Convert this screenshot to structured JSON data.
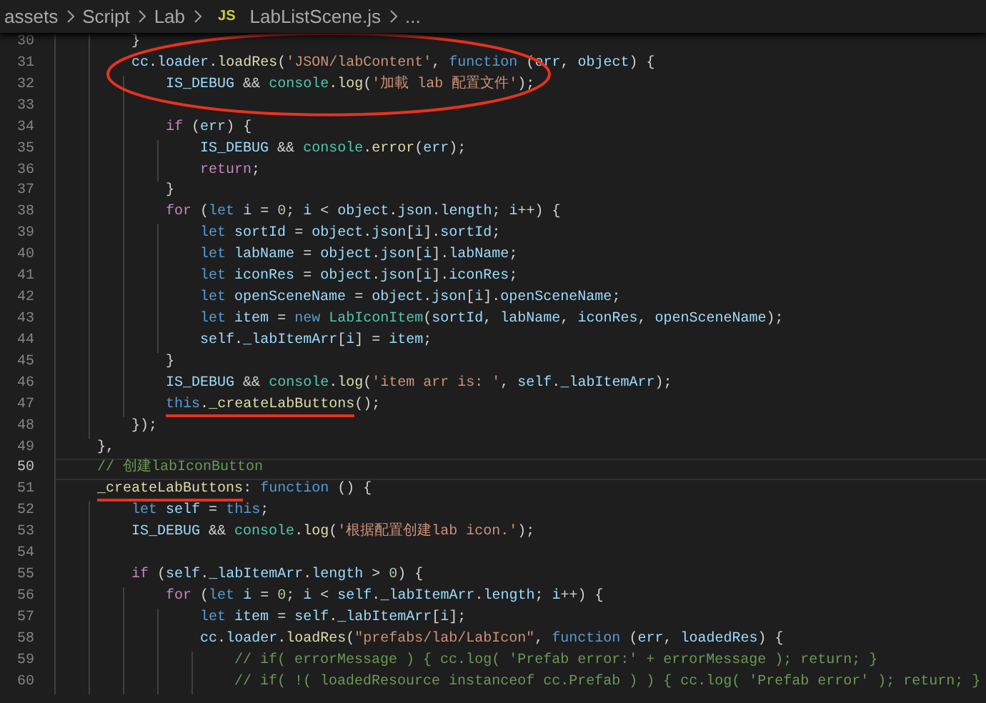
{
  "breadcrumbs": [
    {
      "label": "assets"
    },
    {
      "label": "Script"
    },
    {
      "label": "Lab"
    },
    {
      "label": "LabListScene.js",
      "badge": "JS"
    },
    {
      "label": "..."
    }
  ],
  "lines": [
    {
      "number": "30",
      "current": false,
      "circled": false,
      "tokens": [
        {
          "text": "        }",
          "kind": "plain"
        }
      ]
    },
    {
      "number": "31",
      "current": false,
      "circled": true,
      "tokens": [
        {
          "text": "        cc",
          "kind": "var"
        },
        {
          "text": ".",
          "kind": "plain"
        },
        {
          "text": "loader",
          "kind": "var"
        },
        {
          "text": ".",
          "kind": "plain"
        },
        {
          "text": "loadRes",
          "kind": "function"
        },
        {
          "text": "(",
          "kind": "plain"
        },
        {
          "text": "'JSON/labContent'",
          "kind": "string"
        },
        {
          "text": ", ",
          "kind": "plain"
        },
        {
          "text": "function",
          "kind": "keyword"
        },
        {
          "text": " (",
          "kind": "plain"
        },
        {
          "text": "err",
          "kind": "var"
        },
        {
          "text": ", ",
          "kind": "plain"
        },
        {
          "text": "object",
          "kind": "var"
        },
        {
          "text": ") {",
          "kind": "plain"
        }
      ]
    },
    {
      "number": "32",
      "current": false,
      "circled": true,
      "tokens": [
        {
          "text": "            IS_DEBUG",
          "kind": "var"
        },
        {
          "text": " && ",
          "kind": "plain"
        },
        {
          "text": "console",
          "kind": "type"
        },
        {
          "text": ".",
          "kind": "plain"
        },
        {
          "text": "log",
          "kind": "function"
        },
        {
          "text": "(",
          "kind": "plain"
        },
        {
          "text": "'加載 lab 配置文件'",
          "kind": "string"
        },
        {
          "text": ");",
          "kind": "plain"
        }
      ]
    },
    {
      "number": "33",
      "current": false,
      "circled": false
    },
    {
      "number": "34",
      "current": false,
      "circled": false,
      "tokens": [
        {
          "text": "            if",
          "kind": "control"
        },
        {
          "text": " (",
          "kind": "plain"
        },
        {
          "text": "err",
          "kind": "var"
        },
        {
          "text": ") {",
          "kind": "plain"
        }
      ]
    },
    {
      "number": "35",
      "current": false,
      "circled": false,
      "tokens": [
        {
          "text": "                IS_DEBUG",
          "kind": "var"
        },
        {
          "text": " && ",
          "kind": "plain"
        },
        {
          "text": "console",
          "kind": "type"
        },
        {
          "text": ".",
          "kind": "plain"
        },
        {
          "text": "error",
          "kind": "function"
        },
        {
          "text": "(",
          "kind": "plain"
        },
        {
          "text": "err",
          "kind": "var"
        },
        {
          "text": ");",
          "kind": "plain"
        }
      ]
    },
    {
      "number": "36",
      "current": false,
      "circled": false,
      "tokens": [
        {
          "text": "                return",
          "kind": "control"
        },
        {
          "text": ";",
          "kind": "plain"
        }
      ]
    },
    {
      "number": "37",
      "current": false,
      "circled": false,
      "tokens": [
        {
          "text": "            }",
          "kind": "plain"
        }
      ]
    },
    {
      "number": "38",
      "current": false,
      "circled": false,
      "tokens": [
        {
          "text": "            for",
          "kind": "control"
        },
        {
          "text": " (",
          "kind": "plain"
        },
        {
          "text": "let ",
          "kind": "keyword"
        },
        {
          "text": "i",
          "kind": "var"
        },
        {
          "text": " = ",
          "kind": "plain"
        },
        {
          "text": "0",
          "kind": "number"
        },
        {
          "text": "; ",
          "kind": "plain"
        },
        {
          "text": "i",
          "kind": "var"
        },
        {
          "text": " < ",
          "kind": "plain"
        },
        {
          "text": "object",
          "kind": "var"
        },
        {
          "text": ".",
          "kind": "plain"
        },
        {
          "text": "json",
          "kind": "var"
        },
        {
          "text": ".",
          "kind": "plain"
        },
        {
          "text": "length",
          "kind": "var"
        },
        {
          "text": "; ",
          "kind": "plain"
        },
        {
          "text": "i",
          "kind": "var"
        },
        {
          "text": "++) {",
          "kind": "plain"
        }
      ]
    },
    {
      "number": "39",
      "current": false,
      "circled": false,
      "tokens": [
        {
          "text": "                let ",
          "kind": "keyword"
        },
        {
          "text": "sortId",
          "kind": "var"
        },
        {
          "text": " = ",
          "kind": "plain"
        },
        {
          "text": "object",
          "kind": "var"
        },
        {
          "text": ".",
          "kind": "plain"
        },
        {
          "text": "json",
          "kind": "var"
        },
        {
          "text": "[",
          "kind": "plain"
        },
        {
          "text": "i",
          "kind": "var"
        },
        {
          "text": "].",
          "kind": "plain"
        },
        {
          "text": "sortId",
          "kind": "var"
        },
        {
          "text": ";",
          "kind": "plain"
        }
      ]
    },
    {
      "number": "40",
      "current": false,
      "circled": false,
      "tokens": [
        {
          "text": "                let ",
          "kind": "keyword"
        },
        {
          "text": "labName",
          "kind": "var"
        },
        {
          "text": " = ",
          "kind": "plain"
        },
        {
          "text": "object",
          "kind": "var"
        },
        {
          "text": ".",
          "kind": "plain"
        },
        {
          "text": "json",
          "kind": "var"
        },
        {
          "text": "[",
          "kind": "plain"
        },
        {
          "text": "i",
          "kind": "var"
        },
        {
          "text": "].",
          "kind": "plain"
        },
        {
          "text": "labName",
          "kind": "var"
        },
        {
          "text": ";",
          "kind": "plain"
        }
      ]
    },
    {
      "number": "41",
      "current": false,
      "circled": false,
      "tokens": [
        {
          "text": "                let ",
          "kind": "keyword"
        },
        {
          "text": "iconRes",
          "kind": "var"
        },
        {
          "text": " = ",
          "kind": "plain"
        },
        {
          "text": "object",
          "kind": "var"
        },
        {
          "text": ".",
          "kind": "plain"
        },
        {
          "text": "json",
          "kind": "var"
        },
        {
          "text": "[",
          "kind": "plain"
        },
        {
          "text": "i",
          "kind": "var"
        },
        {
          "text": "].",
          "kind": "plain"
        },
        {
          "text": "iconRes",
          "kind": "var"
        },
        {
          "text": ";",
          "kind": "plain"
        }
      ]
    },
    {
      "number": "42",
      "current": false,
      "circled": false,
      "tokens": [
        {
          "text": "                let ",
          "kind": "keyword"
        },
        {
          "text": "openSceneName",
          "kind": "var"
        },
        {
          "text": " = ",
          "kind": "plain"
        },
        {
          "text": "object",
          "kind": "var"
        },
        {
          "text": ".",
          "kind": "plain"
        },
        {
          "text": "json",
          "kind": "var"
        },
        {
          "text": "[",
          "kind": "plain"
        },
        {
          "text": "i",
          "kind": "var"
        },
        {
          "text": "].",
          "kind": "plain"
        },
        {
          "text": "openSceneName",
          "kind": "var"
        },
        {
          "text": ";",
          "kind": "plain"
        }
      ]
    },
    {
      "number": "43",
      "current": false,
      "circled": false,
      "tokens": [
        {
          "text": "                let ",
          "kind": "keyword"
        },
        {
          "text": "item",
          "kind": "var"
        },
        {
          "text": " = ",
          "kind": "plain"
        },
        {
          "text": "new ",
          "kind": "keyword"
        },
        {
          "text": "LabIconItem",
          "kind": "type"
        },
        {
          "text": "(",
          "kind": "plain"
        },
        {
          "text": "sortId",
          "kind": "var"
        },
        {
          "text": ", ",
          "kind": "plain"
        },
        {
          "text": "labName",
          "kind": "var"
        },
        {
          "text": ", ",
          "kind": "plain"
        },
        {
          "text": "iconRes",
          "kind": "var"
        },
        {
          "text": ", ",
          "kind": "plain"
        },
        {
          "text": "openSceneName",
          "kind": "var"
        },
        {
          "text": ");",
          "kind": "plain"
        }
      ]
    },
    {
      "number": "44",
      "current": false,
      "circled": false,
      "tokens": [
        {
          "text": "                self",
          "kind": "var"
        },
        {
          "text": ".",
          "kind": "plain"
        },
        {
          "text": "_labItemArr",
          "kind": "var"
        },
        {
          "text": "[",
          "kind": "plain"
        },
        {
          "text": "i",
          "kind": "var"
        },
        {
          "text": "] = ",
          "kind": "plain"
        },
        {
          "text": "item",
          "kind": "var"
        },
        {
          "text": ";",
          "kind": "plain"
        }
      ]
    },
    {
      "number": "45",
      "current": false,
      "circled": false,
      "tokens": [
        {
          "text": "            }",
          "kind": "plain"
        }
      ]
    },
    {
      "number": "46",
      "current": false,
      "circled": false,
      "tokens": [
        {
          "text": "            IS_DEBUG",
          "kind": "var"
        },
        {
          "text": " && ",
          "kind": "plain"
        },
        {
          "text": "console",
          "kind": "type"
        },
        {
          "text": ".",
          "kind": "plain"
        },
        {
          "text": "log",
          "kind": "function"
        },
        {
          "text": "(",
          "kind": "plain"
        },
        {
          "text": "'item arr is: '",
          "kind": "string"
        },
        {
          "text": ", ",
          "kind": "plain"
        },
        {
          "text": "self",
          "kind": "var"
        },
        {
          "text": ".",
          "kind": "plain"
        },
        {
          "text": "_labItemArr",
          "kind": "var"
        },
        {
          "text": ");",
          "kind": "plain"
        }
      ]
    },
    {
      "number": "47",
      "current": false,
      "circled": false,
      "tokens": [
        {
          "text": "            this",
          "kind": "keyword",
          "underlined": true
        },
        {
          "text": ".",
          "kind": "plain",
          "underlined": true
        },
        {
          "text": "_createLabButtons",
          "kind": "function",
          "underlined": true
        },
        {
          "text": "();",
          "kind": "plain"
        }
      ]
    },
    {
      "number": "48",
      "current": false,
      "circled": false,
      "tokens": [
        {
          "text": "        });",
          "kind": "plain"
        }
      ]
    },
    {
      "number": "49",
      "current": false,
      "circled": false,
      "tokens": [
        {
          "text": "    },",
          "kind": "plain"
        }
      ]
    },
    {
      "number": "50",
      "current": true,
      "circled": false,
      "tokens": [
        {
          "text": "    // 创建labIconButton",
          "kind": "comment"
        }
      ]
    },
    {
      "number": "51",
      "current": false,
      "circled": false,
      "tokens": [
        {
          "text": "    _createLabButtons",
          "kind": "function",
          "underlined": true
        },
        {
          "text": ": ",
          "kind": "plain"
        },
        {
          "text": "function",
          "kind": "keyword"
        },
        {
          "text": " () {",
          "kind": "plain"
        }
      ]
    },
    {
      "number": "52",
      "current": false,
      "circled": false,
      "tokens": [
        {
          "text": "        let ",
          "kind": "keyword"
        },
        {
          "text": "self",
          "kind": "var"
        },
        {
          "text": " = ",
          "kind": "plain"
        },
        {
          "text": "this",
          "kind": "keyword"
        },
        {
          "text": ";",
          "kind": "plain"
        }
      ]
    },
    {
      "number": "53",
      "current": false,
      "circled": false,
      "tokens": [
        {
          "text": "        IS_DEBUG",
          "kind": "var"
        },
        {
          "text": " && ",
          "kind": "plain"
        },
        {
          "text": "console",
          "kind": "type"
        },
        {
          "text": ".",
          "kind": "plain"
        },
        {
          "text": "log",
          "kind": "function"
        },
        {
          "text": "(",
          "kind": "plain"
        },
        {
          "text": "'根据配置创建lab icon.'",
          "kind": "string"
        },
        {
          "text": ");",
          "kind": "plain"
        }
      ]
    },
    {
      "number": "54",
      "current": false,
      "circled": false
    },
    {
      "number": "55",
      "current": false,
      "circled": false,
      "tokens": [
        {
          "text": "        if",
          "kind": "control"
        },
        {
          "text": " (",
          "kind": "plain"
        },
        {
          "text": "self",
          "kind": "var"
        },
        {
          "text": ".",
          "kind": "plain"
        },
        {
          "text": "_labItemArr",
          "kind": "var"
        },
        {
          "text": ".",
          "kind": "plain"
        },
        {
          "text": "length",
          "kind": "var"
        },
        {
          "text": " > ",
          "kind": "plain"
        },
        {
          "text": "0",
          "kind": "number"
        },
        {
          "text": ") {",
          "kind": "plain"
        }
      ]
    },
    {
      "number": "56",
      "current": false,
      "circled": false,
      "tokens": [
        {
          "text": "            for",
          "kind": "control"
        },
        {
          "text": " (",
          "kind": "plain"
        },
        {
          "text": "let ",
          "kind": "keyword"
        },
        {
          "text": "i",
          "kind": "var"
        },
        {
          "text": " = ",
          "kind": "plain"
        },
        {
          "text": "0",
          "kind": "number"
        },
        {
          "text": "; ",
          "kind": "plain"
        },
        {
          "text": "i",
          "kind": "var"
        },
        {
          "text": " < ",
          "kind": "plain"
        },
        {
          "text": "self",
          "kind": "var"
        },
        {
          "text": ".",
          "kind": "plain"
        },
        {
          "text": "_labItemArr",
          "kind": "var"
        },
        {
          "text": ".",
          "kind": "plain"
        },
        {
          "text": "length",
          "kind": "var"
        },
        {
          "text": "; ",
          "kind": "plain"
        },
        {
          "text": "i",
          "kind": "var"
        },
        {
          "text": "++) {",
          "kind": "plain"
        }
      ]
    },
    {
      "number": "57",
      "current": false,
      "circled": false,
      "tokens": [
        {
          "text": "                let ",
          "kind": "keyword"
        },
        {
          "text": "item",
          "kind": "var"
        },
        {
          "text": " = ",
          "kind": "plain"
        },
        {
          "text": "self",
          "kind": "var"
        },
        {
          "text": ".",
          "kind": "plain"
        },
        {
          "text": "_labItemArr",
          "kind": "var"
        },
        {
          "text": "[",
          "kind": "plain"
        },
        {
          "text": "i",
          "kind": "var"
        },
        {
          "text": "];",
          "kind": "plain"
        }
      ]
    },
    {
      "number": "58",
      "current": false,
      "circled": false,
      "tokens": [
        {
          "text": "                cc",
          "kind": "var"
        },
        {
          "text": ".",
          "kind": "plain"
        },
        {
          "text": "loader",
          "kind": "var"
        },
        {
          "text": ".",
          "kind": "plain"
        },
        {
          "text": "loadRes",
          "kind": "function"
        },
        {
          "text": "(",
          "kind": "plain"
        },
        {
          "text": "\"prefabs/lab/LabIcon\"",
          "kind": "string"
        },
        {
          "text": ", ",
          "kind": "plain"
        },
        {
          "text": "function",
          "kind": "keyword"
        },
        {
          "text": " (",
          "kind": "plain"
        },
        {
          "text": "err",
          "kind": "var"
        },
        {
          "text": ", ",
          "kind": "plain"
        },
        {
          "text": "loadedRes",
          "kind": "var"
        },
        {
          "text": ") {",
          "kind": "plain"
        }
      ]
    },
    {
      "number": "59",
      "current": false,
      "circled": false,
      "tokens": [
        {
          "text": "                    // if( errorMessage ) { cc.log( 'Prefab error:' + errorMessage ); return; }",
          "kind": "comment"
        }
      ]
    },
    {
      "number": "60",
      "current": false,
      "circled": false,
      "tokens": [
        {
          "text": "                    // if( !( loadedResource instanceof cc.Prefab ) ) { cc.log( 'Prefab error' ); return; }",
          "kind": "comment"
        }
      ]
    }
  ]
}
